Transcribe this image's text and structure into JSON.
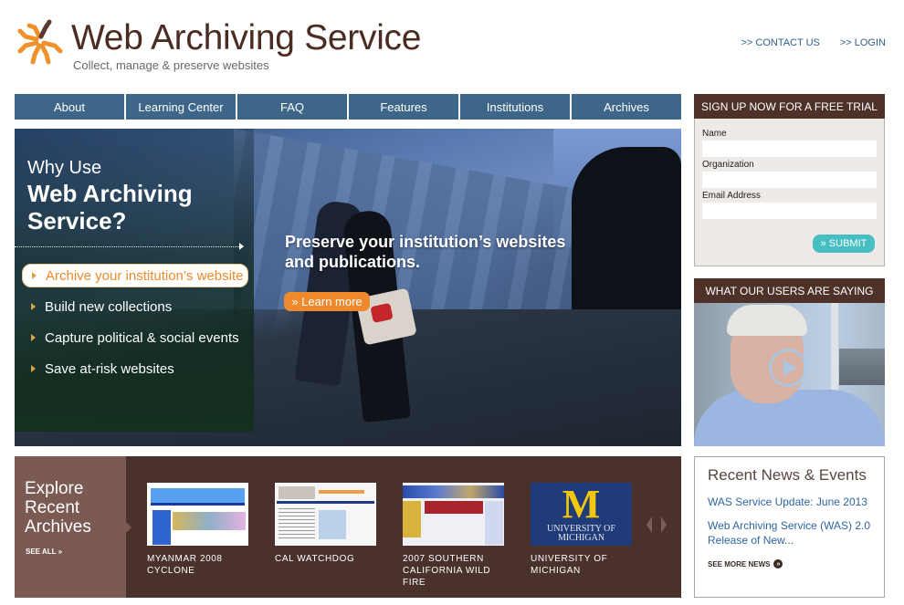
{
  "header": {
    "title": "Web Archiving Service",
    "tagline": "Collect, manage & preserve websites",
    "links": [
      {
        "label": ">> CONTACT US"
      },
      {
        "label": ">> LOGIN"
      }
    ]
  },
  "nav": {
    "items": [
      {
        "label": "About"
      },
      {
        "label": "Learning Center"
      },
      {
        "label": "FAQ"
      },
      {
        "label": "Features"
      },
      {
        "label": "Institutions"
      },
      {
        "label": "Archives"
      }
    ]
  },
  "hero": {
    "why_small": "Why Use",
    "why_big": "Web Archiving Service?",
    "items": [
      {
        "label": "Archive your institution’s website",
        "active": true
      },
      {
        "label": "Build new collections",
        "active": false
      },
      {
        "label": "Capture political & social events",
        "active": false
      },
      {
        "label": "Save at-risk websites",
        "active": false
      }
    ],
    "headline": "Preserve your institution’s websites and publications.",
    "cta_label": "» Learn more"
  },
  "signup": {
    "heading": "SIGN UP NOW FOR A FREE TRIAL",
    "fields": [
      {
        "label": "Name",
        "value": ""
      },
      {
        "label": "Organization",
        "value": ""
      },
      {
        "label": "Email Address",
        "value": ""
      }
    ],
    "submit_label": "» SUBMIT"
  },
  "testimonial": {
    "heading": "WHAT OUR USERS ARE SAYING",
    "play_icon": "play-icon"
  },
  "explore": {
    "title": "Explore Recent Archives",
    "see_all": "SEE ALL »",
    "items": [
      {
        "label": "MYANMAR 2008 CYCLONE"
      },
      {
        "label": "CAL WATCHDOG"
      },
      {
        "label": "2007 SOUTHERN CALIFORNIA WILD FIRE"
      },
      {
        "label": "UNIVERSITY OF MICHIGAN",
        "thumb_letter": "M",
        "thumb_caption": "UNIVERSITY OF MICHIGAN"
      }
    ]
  },
  "news": {
    "title": "Recent News & Events",
    "items": [
      {
        "label": "WAS Service Update: June 2013"
      },
      {
        "label": "Web Archiving Service (WAS) 2.0 Release of New..."
      }
    ],
    "see_more": "SEE MORE NEWS"
  },
  "colors": {
    "brand_brown": "#4e3129",
    "brand_orange": "#ef8a2c",
    "nav_blue": "#3d6689",
    "link_blue": "#2f65a0",
    "submit_teal": "#47bec1"
  }
}
